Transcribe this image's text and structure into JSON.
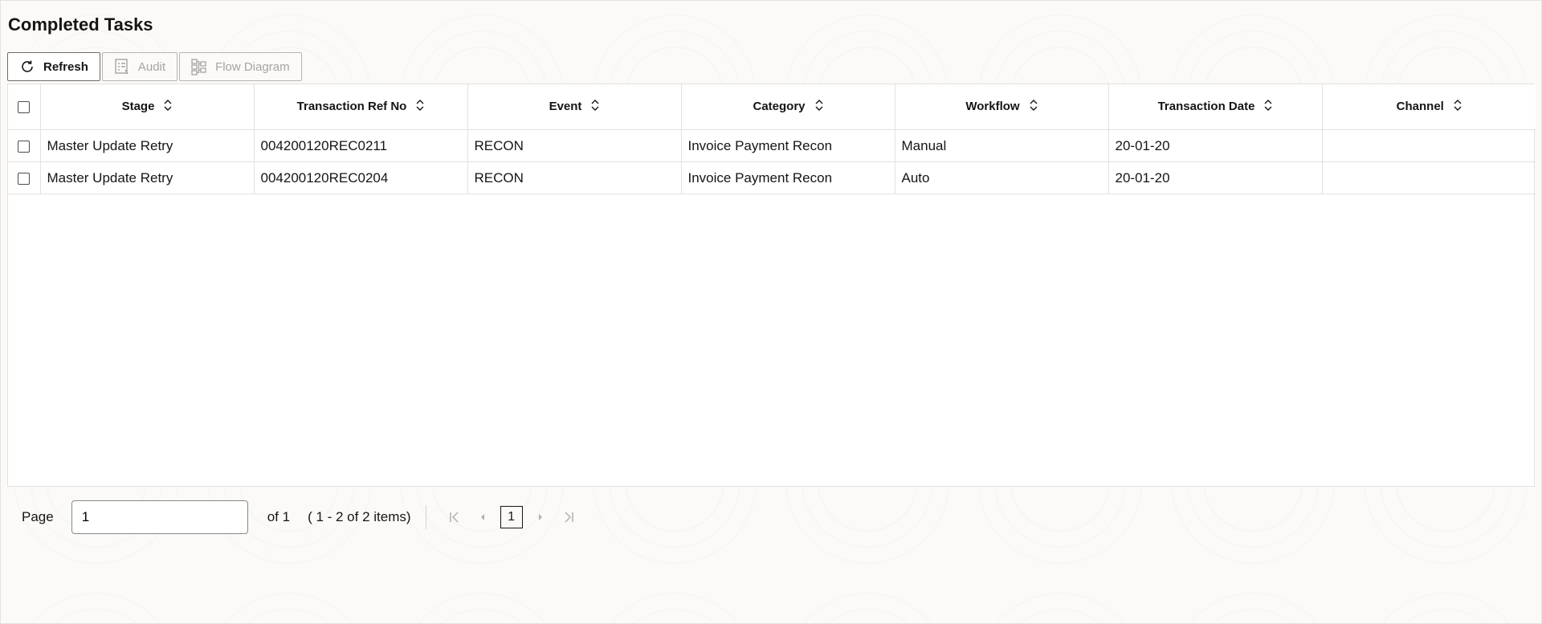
{
  "page": {
    "title": "Completed Tasks"
  },
  "toolbar": {
    "refresh_label": "Refresh",
    "audit_label": "Audit",
    "flow_diagram_label": "Flow Diagram"
  },
  "table": {
    "columns": [
      "Stage",
      "Transaction Ref No",
      "Event",
      "Category",
      "Workflow",
      "Transaction Date",
      "Channel"
    ],
    "rows": [
      {
        "stage": "Master Update Retry",
        "ref_no": "004200120REC0211",
        "event": "RECON",
        "category": "Invoice Payment Recon",
        "workflow": "Manual",
        "date": "20-01-20",
        "channel": ""
      },
      {
        "stage": "Master Update Retry",
        "ref_no": "004200120REC0204",
        "event": "RECON",
        "category": "Invoice Payment Recon",
        "workflow": "Auto",
        "date": "20-01-20",
        "channel": ""
      }
    ]
  },
  "pagination": {
    "page_label": "Page",
    "current_page_value": "1",
    "of_text": "of 1",
    "items_text": "( 1 - 2 of 2 items)",
    "page_number": "1"
  },
  "icons": {
    "refresh": "refresh-icon",
    "audit": "audit-icon",
    "flow_diagram": "flow-diagram-icon",
    "sort": "sort-icon",
    "first": "first-page-icon",
    "prev": "previous-page-icon",
    "next": "next-page-icon",
    "last": "last-page-icon"
  },
  "colors": {
    "text": "#161513",
    "border": "#e3e1dc",
    "disabled": "#a7a4a0"
  }
}
